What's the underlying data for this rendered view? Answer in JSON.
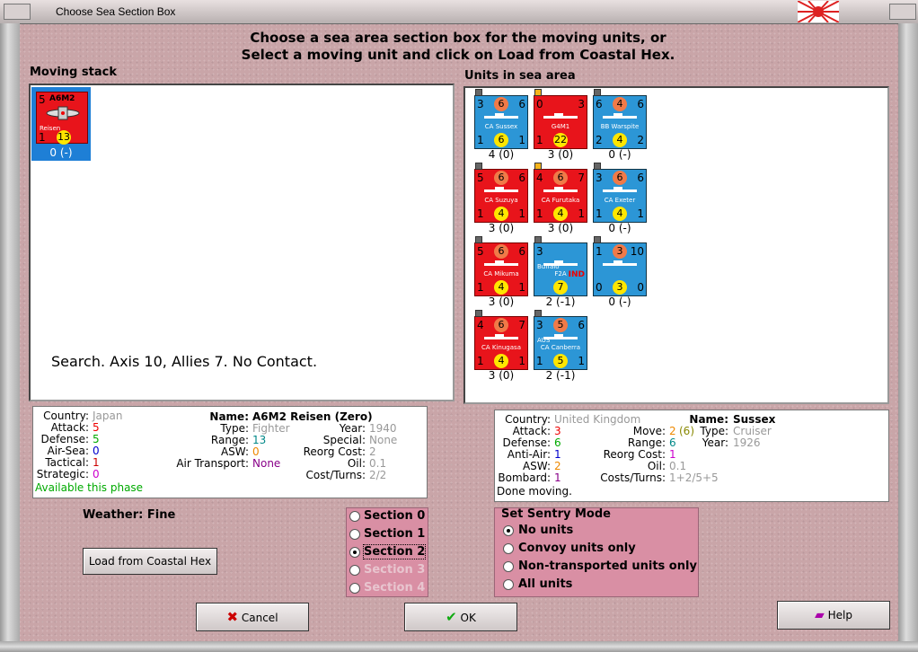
{
  "window": {
    "title": "Choose Sea Section Box"
  },
  "heading": {
    "line1": "Choose a sea area section box for the moving units, or",
    "line2": "Select a moving unit and click on Load from Coastal Hex."
  },
  "moving_stack": {
    "label": "Moving stack",
    "unit": {
      "name": "A6M2",
      "sub": "Reisen",
      "top_left": "5",
      "bottom_left": "1",
      "mid_left": "1",
      "circle": "13",
      "caption": "0 (-)"
    },
    "search_text": "Search.  Axis 10, Allies 7.  No Contact."
  },
  "sea_area": {
    "label": "Units in sea area",
    "units": [
      {
        "name": "CA Sussex",
        "color": "#2c96d6",
        "tl": "3",
        "tc": "6",
        "tr": "6",
        "bl": "1",
        "bc": "6",
        "br": "1",
        "caption": "4 (0)"
      },
      {
        "name": "G4M1",
        "color": "#e8141b",
        "tl": "0",
        "tc": "",
        "tr": "3",
        "bl": "1",
        "bc": "22",
        "br": "",
        "caption": "3 (0)"
      },
      {
        "name": "BB Warspite",
        "color": "#2c96d6",
        "tl": "6",
        "tc": "4",
        "tr": "6",
        "bl": "2",
        "bc": "4",
        "br": "2",
        "caption": "0 (-)"
      },
      {
        "name": "CA Suzuya",
        "color": "#e8141b",
        "tl": "5",
        "tc": "6",
        "tr": "6",
        "bl": "1",
        "bc": "4",
        "br": "1",
        "caption": "3 (0)"
      },
      {
        "name": "CA Furutaka",
        "color": "#e8141b",
        "tl": "4",
        "tc": "6",
        "tr": "7",
        "bl": "1",
        "bc": "4",
        "br": "1",
        "caption": "3 (0)"
      },
      {
        "name": "CA Exeter",
        "color": "#2c96d6",
        "tl": "3",
        "tc": "6",
        "tr": "6",
        "bl": "1",
        "bc": "4",
        "br": "1",
        "caption": "0 (-)"
      },
      {
        "name": "CA Mikuma",
        "color": "#e8141b",
        "tl": "5",
        "tc": "6",
        "tr": "6",
        "bl": "1",
        "bc": "4",
        "br": "1",
        "caption": "3 (0)"
      },
      {
        "name": "F2A",
        "sub": "Buffalo",
        "tag": "IND",
        "color": "#2c96d6",
        "tl": "3",
        "tc": "",
        "tr": "",
        "bl": "",
        "bc": "7",
        "br": "",
        "caption": "2 (-1)"
      },
      {
        "name": "",
        "color": "#2c96d6",
        "tl": "1",
        "tc": "3",
        "tr": "10",
        "bl": "0",
        "bc": "3",
        "br": "0",
        "caption": "0 (-)"
      },
      {
        "name": "CA Kinugasa",
        "color": "#e8141b",
        "tl": "4",
        "tc": "6",
        "tr": "7",
        "bl": "1",
        "bc": "4",
        "br": "1",
        "caption": "3 (0)"
      },
      {
        "name": "CA Canberra",
        "sub": "AUS",
        "color": "#2c96d6",
        "tl": "3",
        "tc": "5",
        "tr": "6",
        "bl": "1",
        "bc": "5",
        "br": "1",
        "caption": "2 (-1)"
      }
    ]
  },
  "left_info": {
    "country_k": "Country:",
    "country_v": "Japan",
    "attack_k": "Attack:",
    "attack_v": "5",
    "defense_k": "Defense:",
    "defense_v": "5",
    "airsea_k": "Air-Sea:",
    "airsea_v": "0",
    "tactical_k": "Tactical:",
    "tactical_v": "1",
    "strategic_k": "Strategic:",
    "strategic_v": "0",
    "available": "Available this phase",
    "name_k": "Name:",
    "name_v": "A6M2 Reisen (Zero)",
    "type_k": "Type:",
    "type_v": "Fighter",
    "range_k": "Range:",
    "range_v": "13",
    "asw_k": "ASW:",
    "asw_v": "0",
    "airtransport_k": "Air Transport:",
    "airtransport_v": "None",
    "year_k": "Year:",
    "year_v": "1940",
    "special_k": "Special:",
    "special_v": "None",
    "reorg_k": "Reorg Cost:",
    "reorg_v": "2",
    "oil_k": "Oil:",
    "oil_v": "0.1",
    "cost_k": "Cost/Turns:",
    "cost_v": "2/2"
  },
  "right_info": {
    "country_k": "Country:",
    "country_v": "United Kingdom",
    "attack_k": "Attack:",
    "attack_v": "3",
    "defense_k": "Defense:",
    "defense_v": "6",
    "antiair_k": "Anti-Air:",
    "antiair_v": "1",
    "asw_k": "ASW:",
    "asw_v": "2",
    "bombard_k": "Bombard:",
    "bombard_v": "1",
    "done": "Done moving.",
    "move_k": "Move:",
    "move_v": "2",
    "move_v2": "(6)",
    "range_k": "Range:",
    "range_v": "6",
    "reorg_k": "Reorg Cost:",
    "reorg_v": "1",
    "oil_k": "Oil:",
    "oil_v": "0.1",
    "cost_k": "Costs/Turns:",
    "cost_v": "1+2/5+5",
    "name_k": "Name:",
    "name_v": "Sussex",
    "type_k": "Type:",
    "type_v": "Cruiser",
    "year_k": "Year:",
    "year_v": "1926"
  },
  "weather": "Weather: Fine",
  "load_button": "Load from Coastal Hex",
  "sections": [
    {
      "label": "Section 0",
      "checked": false,
      "enabled": true
    },
    {
      "label": "Section 1",
      "checked": false,
      "enabled": true
    },
    {
      "label": "Section 2",
      "checked": true,
      "enabled": true
    },
    {
      "label": "Section 3",
      "checked": false,
      "enabled": false
    },
    {
      "label": "Section 4",
      "checked": false,
      "enabled": false
    }
  ],
  "sentry": {
    "title": "Set Sentry Mode",
    "options": [
      {
        "label": "No units",
        "checked": true
      },
      {
        "label": "Convoy units only",
        "checked": false
      },
      {
        "label": "Non-transported units only",
        "checked": false
      },
      {
        "label": "All units",
        "checked": false
      }
    ]
  },
  "buttons": {
    "cancel": "Cancel",
    "ok": "OK",
    "help": "Help"
  }
}
